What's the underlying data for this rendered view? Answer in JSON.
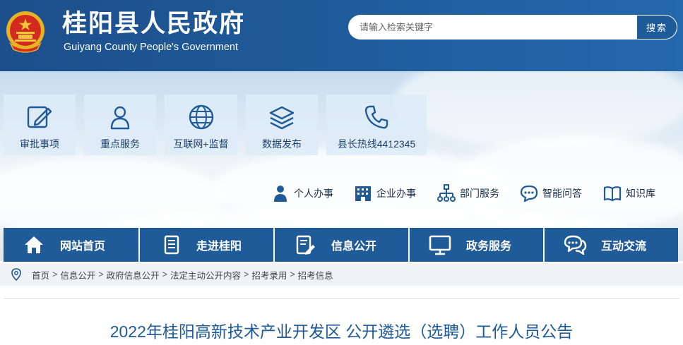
{
  "header": {
    "title": "桂阳县人民政府",
    "subtitle": "Guiyang County People's Government",
    "search_placeholder": "请输入检索关键字",
    "search_button": "搜索"
  },
  "tiles": [
    {
      "label": "审批事项",
      "icon": "edit-icon"
    },
    {
      "label": "重点服务",
      "icon": "user-icon"
    },
    {
      "label": "互联网+监督",
      "icon": "globe-icon"
    },
    {
      "label": "数据发布",
      "icon": "layers-icon"
    },
    {
      "label": "县长热线4412345",
      "icon": "phone-icon"
    }
  ],
  "quick_links": [
    {
      "label": "个人办事",
      "icon": "person-icon"
    },
    {
      "label": "企业办事",
      "icon": "building-icon"
    },
    {
      "label": "部门服务",
      "icon": "org-chart-icon"
    },
    {
      "label": "智能问答",
      "icon": "chat-icon"
    },
    {
      "label": "知识库",
      "icon": "book-icon"
    }
  ],
  "nav": [
    {
      "label": "网站首页",
      "icon": "home-icon"
    },
    {
      "label": "走进桂阳",
      "icon": "document-icon"
    },
    {
      "label": "信息公开",
      "icon": "file-edit-icon"
    },
    {
      "label": "政务服务",
      "icon": "monitor-icon"
    },
    {
      "label": "互动交流",
      "icon": "chat-bubbles-icon"
    }
  ],
  "breadcrumb": [
    "首页",
    "信息公开",
    "政府信息公开",
    "法定主动公开内容",
    "招考录用",
    "招考信息"
  ],
  "breadcrumb_separator": ">",
  "article": {
    "title": "2022年桂阳高新技术产业开发区 公开遴选（选聘）工作人员公告"
  },
  "colors": {
    "brand": "#1f5a99",
    "tile_text": "#1b3f6b",
    "crumb_bg": "#f1f2f4"
  }
}
